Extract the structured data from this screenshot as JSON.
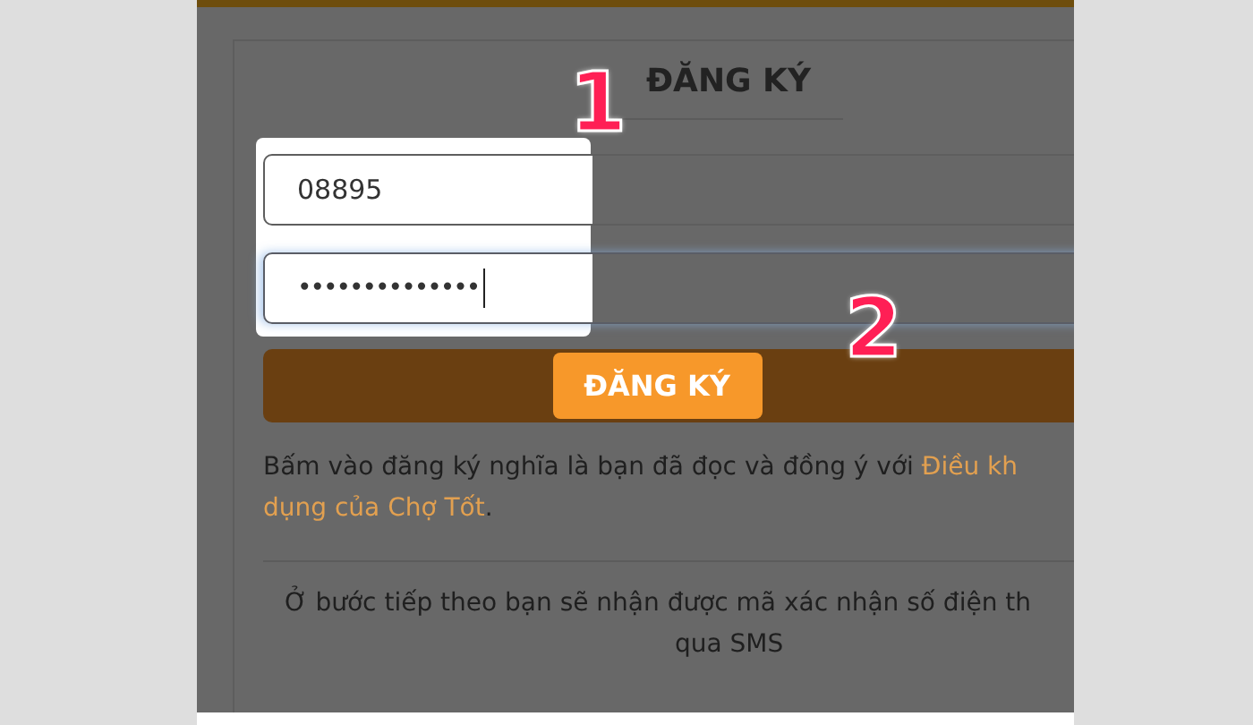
{
  "title": "ĐĂNG KÝ",
  "fields": [
    {
      "kind": "text",
      "value": "08895",
      "focused": false
    },
    {
      "kind": "password",
      "value": "••••••••••••••",
      "focused": true
    }
  ],
  "submit_button": {
    "label": "ĐĂNG KÝ"
  },
  "terms": {
    "text": "Bấm vào đăng ký nghĩa là bạn đã đọc và đồng ý với ",
    "link_line_1": "Điều kh",
    "link_line_2": "dụng của Chợ Tốt",
    "text_after": "."
  },
  "sms_note": [
    "Ở bước tiếp theo bạn sẽ nhận được mã xác nhận số điện th",
    "qua SMS"
  ],
  "step_markers": [
    {
      "label": "1"
    },
    {
      "label": "2"
    }
  ]
}
